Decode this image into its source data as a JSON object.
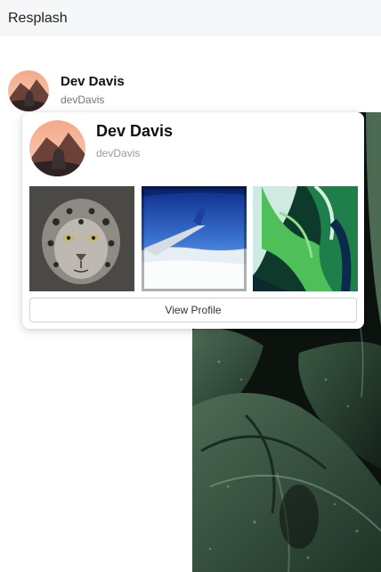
{
  "app": {
    "title": "Resplash"
  },
  "user": {
    "name": "Dev Davis",
    "handle": "devDavis"
  },
  "hover_card": {
    "name": "Dev Davis",
    "handle": "devDavis",
    "photos": [
      {
        "subject": "snow leopard"
      },
      {
        "subject": "airplane wing above clouds"
      },
      {
        "subject": "green fluid art"
      }
    ],
    "view_profile_label": "View Profile"
  },
  "background_photo": {
    "subject": "monstera leaves with water droplets"
  }
}
